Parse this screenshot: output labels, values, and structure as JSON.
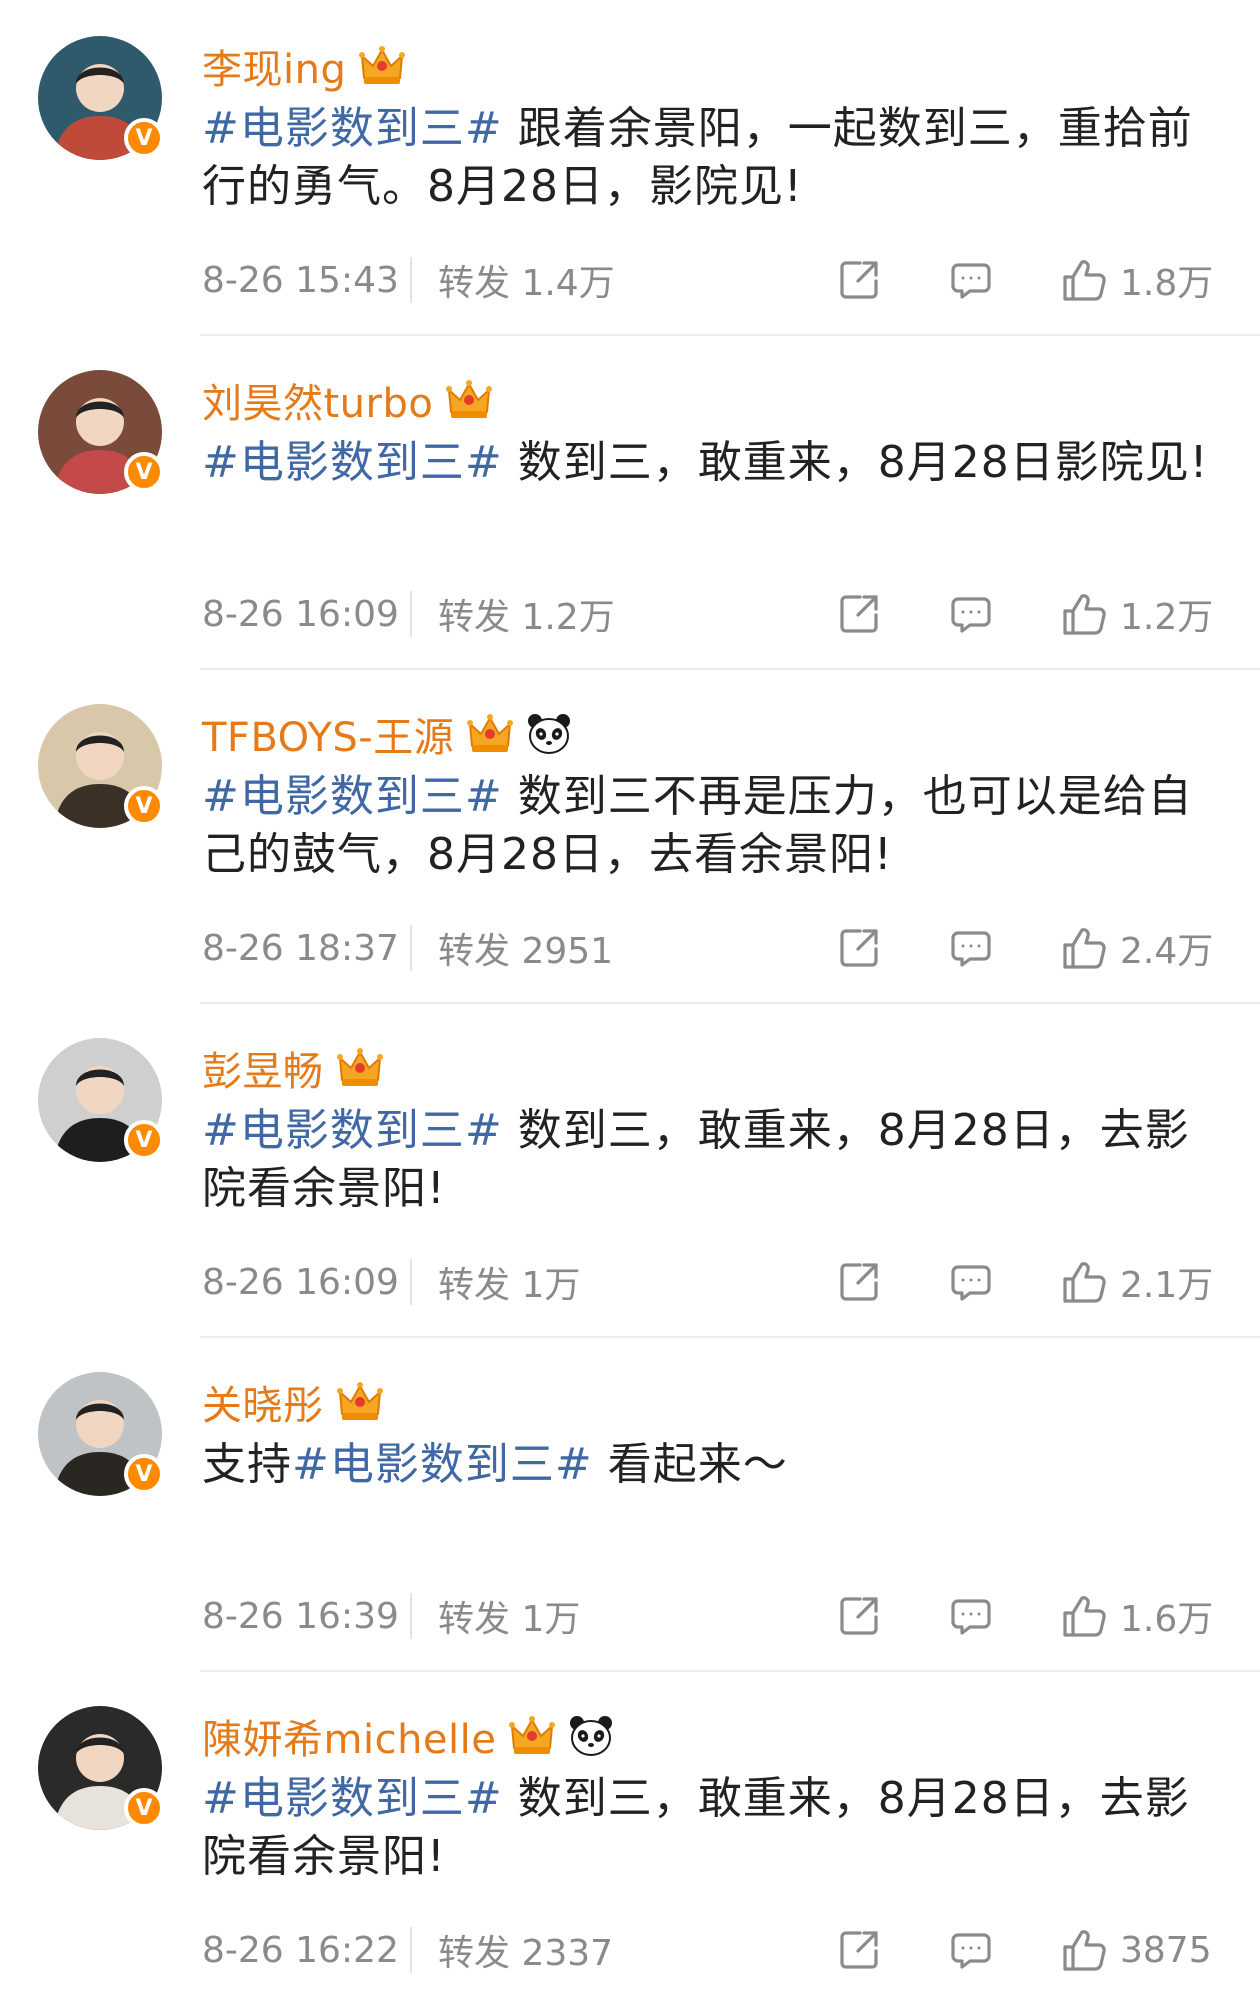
{
  "posts": [
    {
      "username": "李现ing",
      "badge_icon": "crown-badge-icon",
      "has_panda": false,
      "prefix": "",
      "hashtag": "#电影数到三#",
      "body": " 跟着余景阳，一起数到三，重拾前行的勇气。8月28日，影院见!",
      "time": "8-26 15:43",
      "repost": "转发 1.4万",
      "likes": "1.8万",
      "avatar_colors": [
        "#2f5a6b",
        "#c04a3a"
      ]
    },
    {
      "username": "刘昊然turbo",
      "badge_icon": "crown-badge-icon",
      "has_panda": false,
      "prefix": "",
      "hashtag": "#电影数到三#",
      "body": " 数到三，敢重来，8月28日影院见!",
      "time": "8-26 16:09",
      "repost": "转发 1.2万",
      "likes": "1.2万",
      "avatar_colors": [
        "#7a4a3a",
        "#c44a4a"
      ]
    },
    {
      "username": "TFBOYS-王源",
      "badge_icon": "crown-badge-icon",
      "has_panda": true,
      "prefix": "",
      "hashtag": "#电影数到三#",
      "body": " 数到三不再是压力，也可以是给自己的鼓气，8月28日，去看余景阳!",
      "time": "8-26 18:37",
      "repost": "转发 2951",
      "likes": "2.4万",
      "avatar_colors": [
        "#d8c7a8",
        "#3a3026"
      ]
    },
    {
      "username": "彭昱畅",
      "badge_icon": "crown-badge-icon",
      "has_panda": false,
      "prefix": "",
      "hashtag": "#电影数到三#",
      "body": " 数到三，敢重来，8月28日，去影院看余景阳!",
      "time": "8-26 16:09",
      "repost": "转发 1万",
      "likes": "2.1万",
      "avatar_colors": [
        "#cfcfcf",
        "#1e1e1e"
      ]
    },
    {
      "username": "关晓彤",
      "badge_icon": "crown-badge-icon",
      "has_panda": false,
      "prefix": "支持",
      "hashtag": "#电影数到三#",
      "body": " 看起来～",
      "time": "8-26 16:39",
      "repost": "转发 1万",
      "likes": "1.6万",
      "avatar_colors": [
        "#bfc3c6",
        "#2a2622"
      ]
    },
    {
      "username": "陳妍希michelle",
      "badge_icon": "crown-badge-icon",
      "has_panda": true,
      "prefix": "",
      "hashtag": "#电影数到三#",
      "body": " 数到三，敢重来，8月28日，去影院看余景阳!",
      "time": "8-26 16:22",
      "repost": "转发 2337",
      "likes": "3875",
      "avatar_colors": [
        "#2a2a2a",
        "#e8e2dc"
      ]
    }
  ],
  "icons": {
    "verified": "verified-v-icon",
    "verified_glyph": "V",
    "share": "share-icon",
    "comment": "comment-icon",
    "like": "thumbs-up-icon"
  },
  "colors": {
    "username": "#e57a19",
    "hashtag": "#3f68a4",
    "meta": "#8a8a8a",
    "verified": "#ff8a00"
  }
}
